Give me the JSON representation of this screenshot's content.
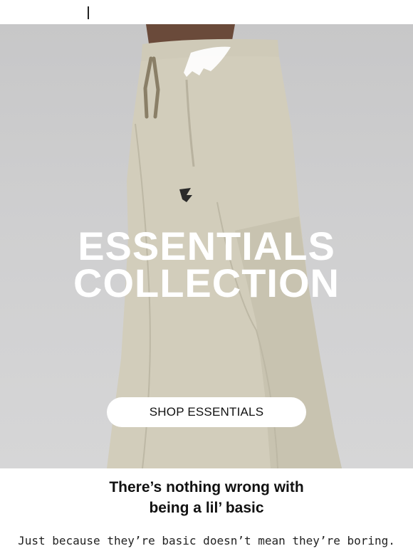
{
  "hero": {
    "title_line1": "ESSENTIALS",
    "title_line2": "COLLECTION",
    "cta_label": "SHOP ESSENTIALS",
    "brand_icon": "gymshark-logo-icon"
  },
  "content": {
    "headline_line1": "There’s nothing wrong with",
    "headline_line2": "being a lil’ basic",
    "body": "Just because they’re basic doesn’t mean they’re boring."
  },
  "colors": {
    "hero_background": "#cfcfd0",
    "title_text": "#ffffff",
    "cta_background": "#ffffff",
    "text": "#111111"
  }
}
